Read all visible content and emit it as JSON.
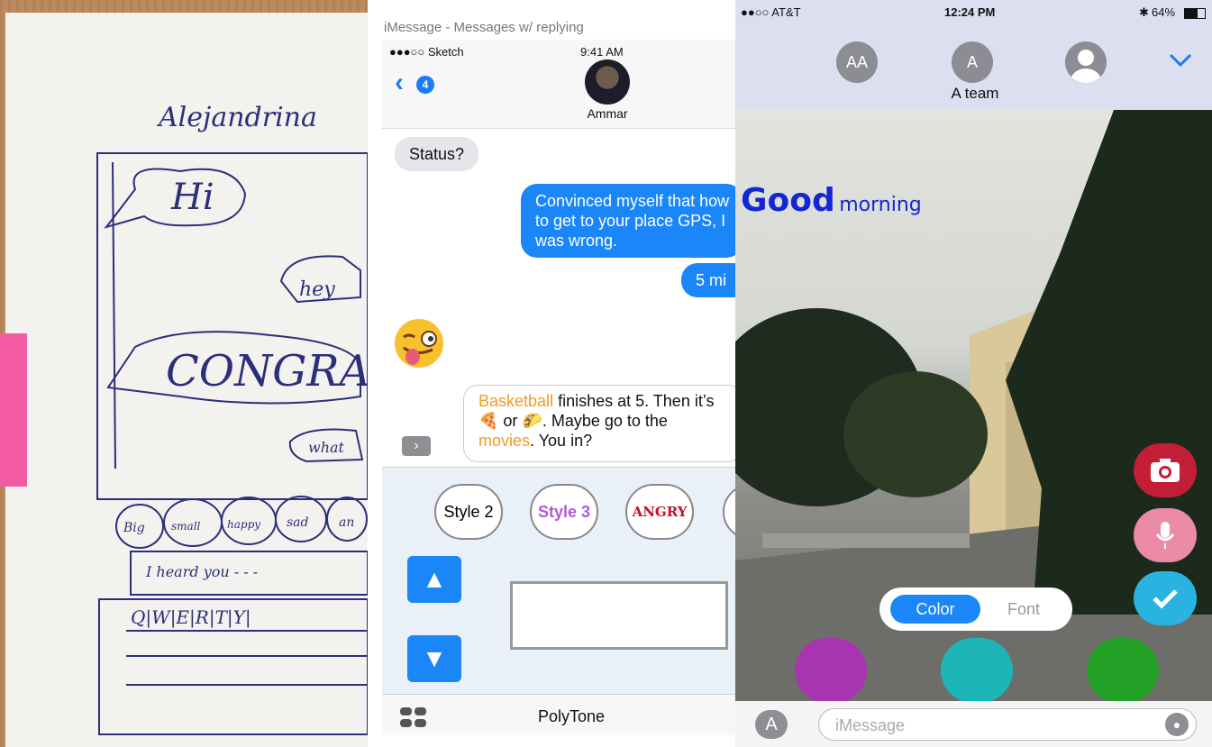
{
  "sketch": {
    "name": "Alejandrina",
    "bubbles": [
      "Hi",
      "hey",
      "CONGRAT",
      "what"
    ],
    "style_row": [
      "Big",
      "small",
      "happy",
      "sad",
      "an"
    ],
    "input_text": "I heard you - - -",
    "keyboard_row": "Q|W|E|R|T|Y|"
  },
  "app": {
    "window_title": "iMessage - Messages w/ replying",
    "status": {
      "carrier": "●●●○○ Sketch",
      "time": "9:41 AM"
    },
    "back_badge": "4",
    "contact_name": "Ammar",
    "messages": {
      "status": "Status?",
      "long_sent": "Convinced myself that how to get to your place GPS, I was wrong.",
      "short_sent": "5 mi"
    },
    "quoted": {
      "p1": "Basketball",
      "p2": " finishes at 5.  Then it’s ",
      "p3": " or ",
      "p4": ".  Maybe go to the ",
      "p5": "movies",
      "p6": ".  You in?"
    },
    "suggest_icon": "chevron-right-icon",
    "styles": [
      "Style 2",
      "Style 3",
      "ANGRY",
      ""
    ],
    "arrow_up": "▲",
    "arrow_down": "▼",
    "tab_name": "PolyTone"
  },
  "photo_app": {
    "status": {
      "carrier": "●●○○ AT&T",
      "time": "12:24 PM",
      "battery": "64%"
    },
    "avatars": [
      "AA",
      "A",
      ""
    ],
    "group_name": "A team",
    "caption": {
      "bold": "Good",
      "rest": "morning"
    },
    "segment": {
      "color": "Color",
      "font": "Font"
    },
    "swatches": [
      "#a834b0",
      "#1cb5b8",
      "#22a025"
    ],
    "fab_colors": {
      "camera": "#c21f37",
      "mic": "#ea8aa7",
      "check": "#29b3e0"
    },
    "input_placeholder": "iMessage"
  }
}
